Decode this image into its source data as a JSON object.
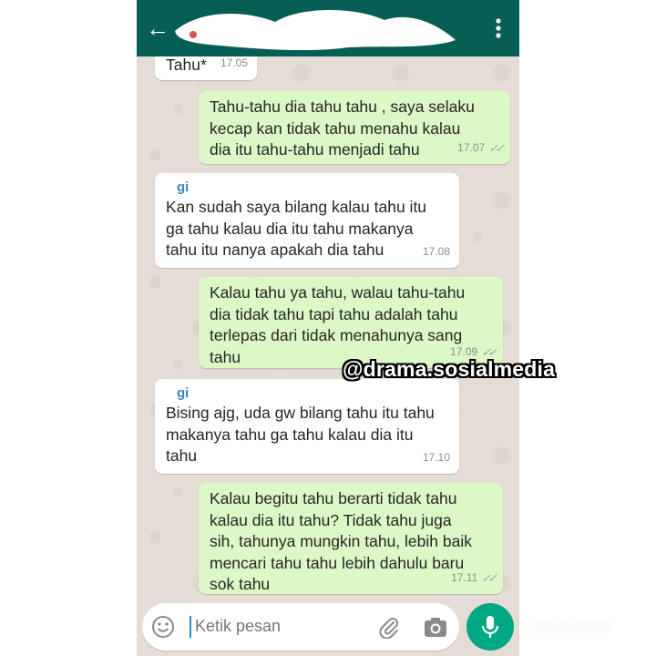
{
  "colors": {
    "header": "#075e54",
    "incoming_bubble": "#ffffff",
    "outgoing_bubble": "#dcf8c6",
    "sender_name": "#3a86c8",
    "mic_button": "#00a884"
  },
  "header": {
    "back_icon": "arrow-left-icon",
    "menu_icon": "more-vert-icon"
  },
  "messages": [
    {
      "direction": "in",
      "text": "Tahu*",
      "time": "17.05"
    },
    {
      "direction": "out",
      "text": "Tahu-tahu dia tahu tahu , saya selaku\nkecap kan tidak tahu menahu kalau\ndia itu tahu-tahu menjadi tahu",
      "time": "17.07",
      "ticks": "✓✓"
    },
    {
      "direction": "in",
      "sender": "gi",
      "text": "Kan sudah saya bilang kalau tahu itu\nga tahu kalau dia itu tahu makanya\ntahu itu nanya apakah dia tahu",
      "time": "17.08"
    },
    {
      "direction": "out",
      "text": "Kalau tahu ya tahu, walau tahu-tahu\ndia tidak tahu tapi tahu adalah tahu\nterlepas dari tidak menahunya sang\ntahu",
      "time": "17.09",
      "ticks": "✓✓"
    },
    {
      "direction": "in",
      "sender": "gi",
      "text": "Bising ajg, uda gw bilang tahu itu tahu\nmakanya tahu ga tahu kalau dia itu\ntahu",
      "time": "17.10"
    },
    {
      "direction": "out",
      "text": "Kalau begitu tahu berarti tidak tahu\nkalau dia itu tahu? Tidak tahu juga\nsih,  tahunya mungkin tahu, lebih baik\nmencari tahu tahu lebih dahulu baru\nsok tahu",
      "time": "17.11",
      "ticks": "✓✓"
    }
  ],
  "watermark": "@drama.sosialmedia",
  "composer": {
    "placeholder": "Ketik pesan",
    "emoji_icon": "emoji-icon",
    "attach_icon": "paperclip-icon",
    "camera_icon": "camera-icon",
    "mic_icon": "mic-icon"
  },
  "photogrid": "PhotoGrid"
}
